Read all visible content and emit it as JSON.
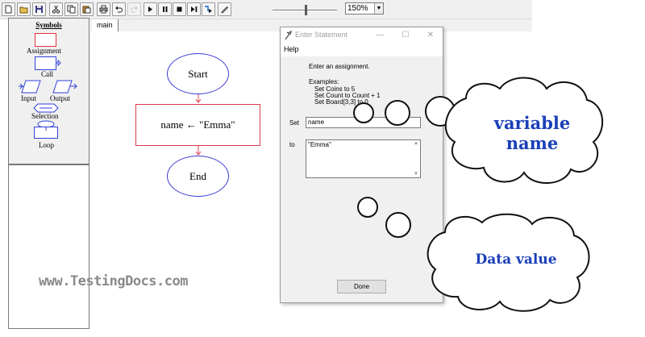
{
  "toolbar": {
    "buttons": [
      "new-icon",
      "open-icon",
      "save-icon",
      "cut-icon",
      "copy-icon",
      "paste-icon",
      "print-icon",
      "undo-icon",
      "redo-icon",
      "run-icon",
      "pause-icon",
      "stop-icon",
      "step-icon",
      "step-into-icon",
      "edit-icon"
    ],
    "zoom_level": "150%"
  },
  "palette": {
    "title": "Symbols",
    "items": {
      "assignment": "Assignment",
      "call": "Call",
      "input": "Input",
      "output": "Output",
      "selection": "Selection",
      "loop": "Loop"
    }
  },
  "tabs": [
    "main"
  ],
  "flowchart": {
    "start": "Start",
    "assignment": "name ← \"Emma\"",
    "end": "End"
  },
  "dialog": {
    "title": "Enter Statement",
    "menu": "Help",
    "instruction": "Enter an assignment.",
    "examples_label": "Examples:",
    "examples": [
      "Set Coins to 5",
      "Set Count to Count + 1",
      "Set Board[3,3] to 0"
    ],
    "set_label": "Set",
    "set_value": "name",
    "to_label": "to",
    "to_value": "\"Emma\"",
    "done_button": "Done"
  },
  "callouts": {
    "variable": "variable name",
    "variable_lines": [
      "variable",
      "name"
    ],
    "data": "Data value"
  },
  "watermark": "www.TestingDocs.com",
  "colors": {
    "oval_border": "#3b3bd4",
    "rect_border": "#d83b4a",
    "callout_text": "#1a3fb8",
    "watermark": "#8a8a8a"
  }
}
